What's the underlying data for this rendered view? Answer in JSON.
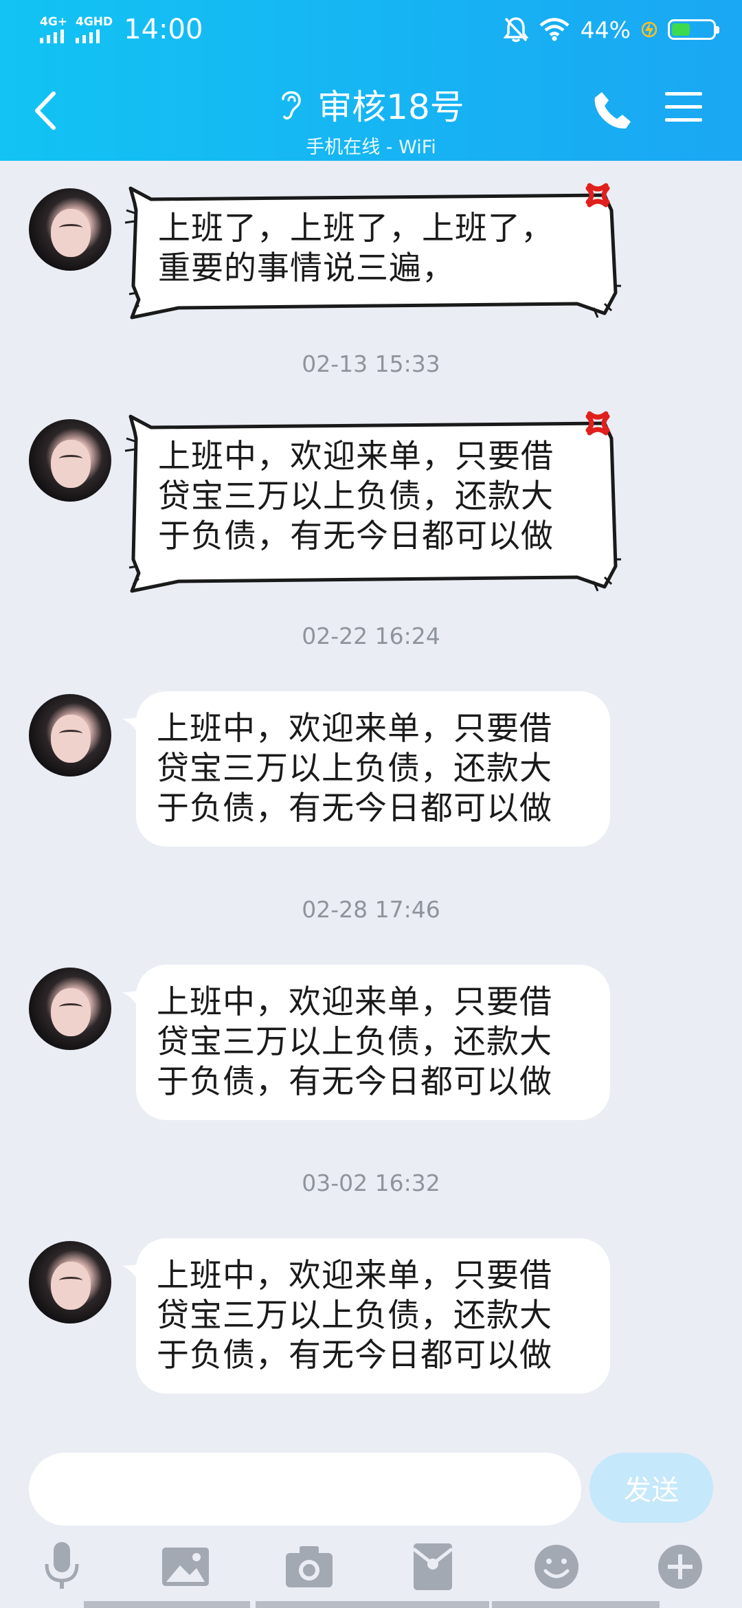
{
  "status_bar": {
    "signal1_label": "4G+",
    "signal2_label": "4GHD",
    "time": "14:00",
    "battery_percent": "44%",
    "battery_level": 0.44,
    "icons": [
      "bell-muted-icon",
      "wifi-icon",
      "charging-icon",
      "battery-icon"
    ]
  },
  "header": {
    "title": "审核18号",
    "subtitle": "手机在线 - WiFi",
    "icons": [
      "back-arrow-icon",
      "ear-icon",
      "phone-icon",
      "menu-icon"
    ],
    "background_color": "#14b8f3"
  },
  "messages": [
    {
      "style": "comic",
      "lines": [
        "上班了，上班了，上班了，",
        "重要的事情说三遍，"
      ]
    },
    {
      "timestamp": "02-13 15:33"
    },
    {
      "style": "comic",
      "lines": [
        "上班中，欢迎来单，只要借",
        "贷宝三万以上负债，还款大",
        "于负债，有无今日都可以做"
      ]
    },
    {
      "timestamp": "02-22 16:24"
    },
    {
      "style": "normal",
      "lines": [
        "上班中，欢迎来单，只要借",
        "贷宝三万以上负债，还款大",
        "于负债，有无今日都可以做"
      ]
    },
    {
      "timestamp": "02-28 17:46"
    },
    {
      "style": "normal",
      "lines": [
        "上班中，欢迎来单，只要借",
        "贷宝三万以上负债，还款大",
        "于负债，有无今日都可以做"
      ]
    },
    {
      "timestamp": "03-02 16:32"
    },
    {
      "style": "normal",
      "lines": [
        "上班中，欢迎来单，只要借",
        "贷宝三万以上负债，还款大",
        "于负债，有无今日都可以做"
      ]
    }
  ],
  "input": {
    "value": "",
    "send_label": "发送"
  },
  "toolbar": {
    "icons": [
      "microphone-icon",
      "image-icon",
      "camera-icon",
      "red-packet-icon",
      "emoji-icon",
      "plus-icon"
    ]
  }
}
